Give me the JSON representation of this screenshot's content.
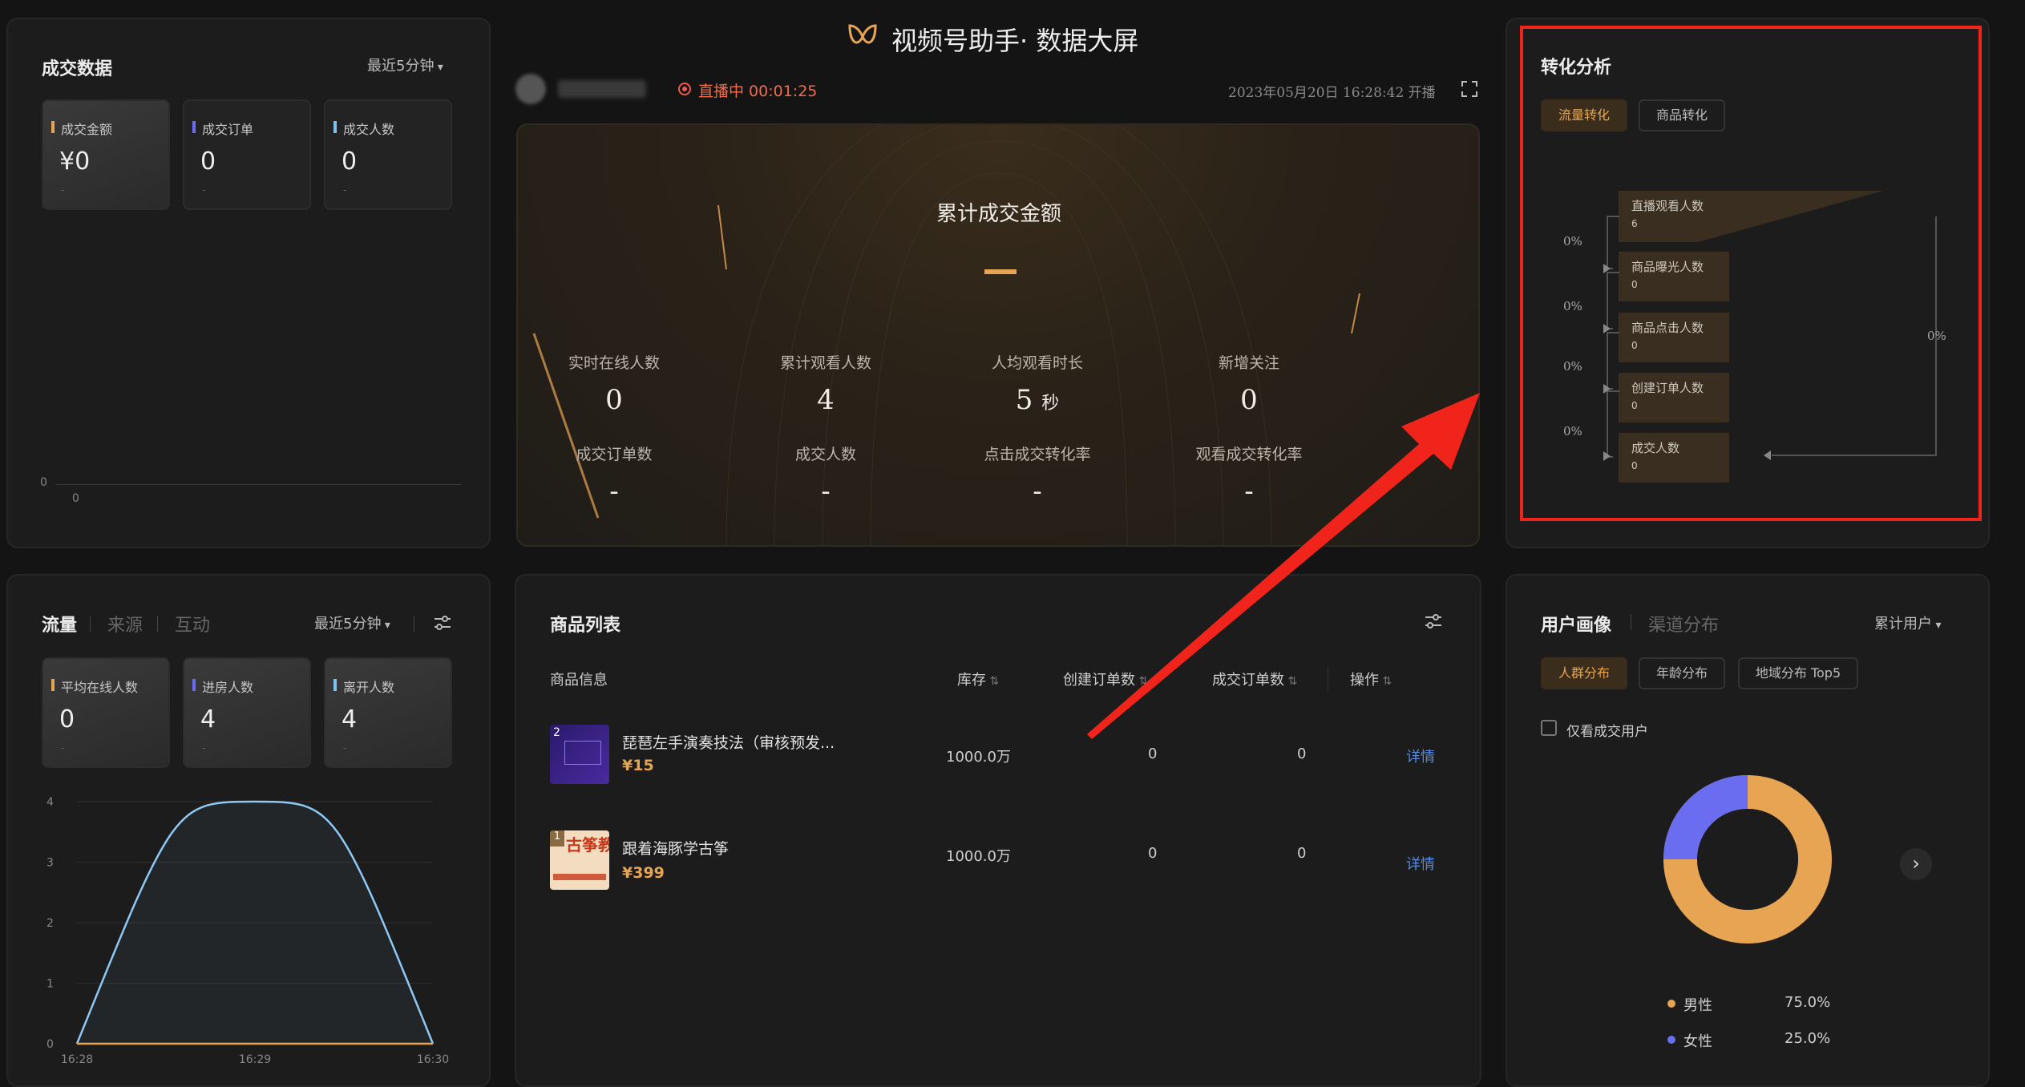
{
  "header": {
    "title": "视频号助手·  数据大屏",
    "live_status": "直播中 00:01:25",
    "start_time": "2023年05月20日 16:28:42 开播"
  },
  "deal": {
    "title": "成交数据",
    "range": "最近5分钟",
    "cards": [
      {
        "label": "成交金额",
        "value": "¥0",
        "sub": "-",
        "color": "#e7a452"
      },
      {
        "label": "成交订单",
        "value": "0",
        "sub": "-",
        "color": "#6b6df0"
      },
      {
        "label": "成交人数",
        "value": "0",
        "sub": "-",
        "color": "#7cc3f0"
      }
    ],
    "axis_y": "0",
    "axis_x": "0"
  },
  "hero": {
    "title": "累计成交金额",
    "value": "—",
    "stats": [
      {
        "label": "实时在线人数",
        "value": "0"
      },
      {
        "label": "累计观看人数",
        "value": "4"
      },
      {
        "label": "人均观看时长",
        "value": "5",
        "unit": "秒"
      },
      {
        "label": "新增关注",
        "value": "0"
      },
      {
        "label": "成交订单数",
        "value": "-"
      },
      {
        "label": "成交人数",
        "value": "-"
      },
      {
        "label": "点击成交转化率",
        "value": "-"
      },
      {
        "label": "观看成交转化率",
        "value": "-"
      }
    ]
  },
  "conversion": {
    "title": "转化分析",
    "tabs": [
      "流量转化",
      "商品转化"
    ],
    "steps": [
      {
        "label": "直播观看人数",
        "value": "6"
      },
      {
        "label": "商品曝光人数",
        "value": "0"
      },
      {
        "label": "商品点击人数",
        "value": "0"
      },
      {
        "label": "创建订单人数",
        "value": "0"
      },
      {
        "label": "成交人数",
        "value": "0"
      }
    ],
    "rates": [
      "0%",
      "0%",
      "0%",
      "0%"
    ],
    "overall": "0%"
  },
  "traffic": {
    "tabs": [
      "流量",
      "来源",
      "互动"
    ],
    "range": "最近5分钟",
    "cards": [
      {
        "label": "平均在线人数",
        "value": "0",
        "sub": "-",
        "color": "#e7a452"
      },
      {
        "label": "进房人数",
        "value": "4",
        "sub": "-",
        "color": "#6b6df0"
      },
      {
        "label": "离开人数",
        "value": "4",
        "sub": "-",
        "color": "#7cc3f0"
      }
    ]
  },
  "chart_data": {
    "type": "line",
    "x": [
      "16:28",
      "16:29",
      "16:30"
    ],
    "ylim": [
      0,
      4
    ],
    "yticks": [
      "0",
      "1",
      "2",
      "3",
      "4"
    ],
    "series": [
      {
        "values": [
          0,
          4,
          0
        ],
        "color": "#8ec8f5"
      },
      {
        "values": [
          0,
          0,
          0
        ],
        "color": "#e7a452"
      }
    ]
  },
  "products": {
    "title": "商品列表",
    "columns": [
      "商品信息",
      "库存",
      "创建订单数",
      "成交订单数",
      "操作"
    ],
    "rows": [
      {
        "name": "琵琶左手演奏技法（审核预发...",
        "price": "¥15",
        "stock": "1000.0万",
        "created": "0",
        "deals": "0",
        "action": "详情",
        "badge": "2"
      },
      {
        "name": "跟着海豚学古筝",
        "price": "¥399",
        "stock": "1000.0万",
        "created": "0",
        "deals": "0",
        "action": "详情",
        "badge": "1",
        "thumb_text": "古筝教"
      }
    ]
  },
  "users": {
    "tabs": [
      "用户画像",
      "渠道分布"
    ],
    "range": "累计用户",
    "filters": [
      "人群分布",
      "年龄分布",
      "地域分布 Top5"
    ],
    "only_deal": "仅看成交用户",
    "legend": [
      {
        "label": "男性",
        "value": "75.0%",
        "color": "#e7a452"
      },
      {
        "label": "女性",
        "value": "25.0%",
        "color": "#6b6df0"
      }
    ],
    "donut": [
      0.75,
      0.25
    ]
  }
}
